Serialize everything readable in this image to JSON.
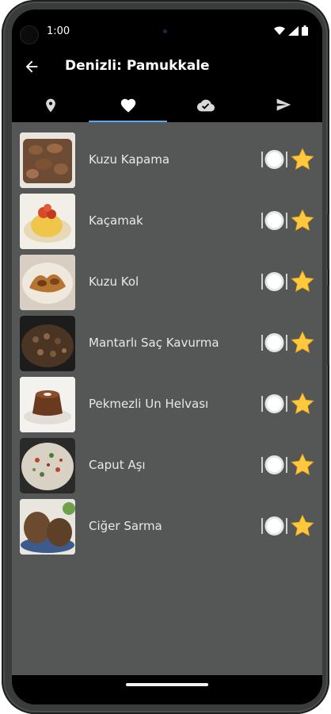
{
  "status_bar": {
    "time": "1:00",
    "icons": [
      "wifi-icon",
      "signal-icon",
      "battery-icon"
    ]
  },
  "app_bar": {
    "title": "Denizli: Pamukkale",
    "back_icon": "arrow-left-icon"
  },
  "tabs": [
    {
      "icon": "location-pin-icon",
      "selected": false
    },
    {
      "icon": "heart-icon",
      "selected": true
    },
    {
      "icon": "cloud-check-icon",
      "selected": false
    },
    {
      "icon": "send-icon",
      "selected": false
    }
  ],
  "recipes": [
    {
      "name": "Kuzu Kapama",
      "image": "lamb-stew-photo"
    },
    {
      "name": "Kaçamak",
      "image": "cornmeal-dish-photo"
    },
    {
      "name": "Kuzu Kol",
      "image": "lamb-shoulder-photo"
    },
    {
      "name": "Mantarlı Saç Kavurma",
      "image": "mushroom-saute-photo"
    },
    {
      "name": "Pekmezli Un Helvası",
      "image": "molasses-halva-photo"
    },
    {
      "name": "Caput Aşı",
      "image": "caput-asi-photo"
    },
    {
      "name": "Ciğer Sarma",
      "image": "liver-wrap-photo"
    }
  ],
  "colors": {
    "list_background": "#555756",
    "tab_indicator": "#5aa7e6",
    "star": "#ffc83d",
    "bar_background": "#000000"
  }
}
